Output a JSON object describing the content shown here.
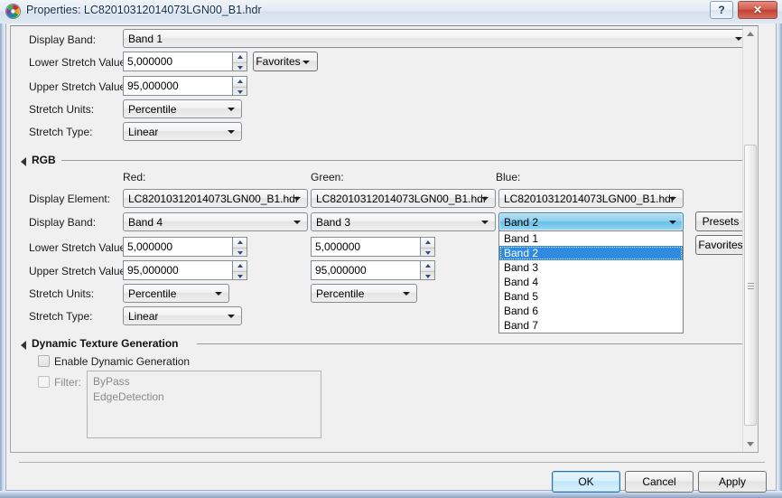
{
  "window": {
    "title": "Properties: LC82010312014073LGN00_B1.hdr",
    "icon": "aperture-logo-icon",
    "help_label": "?",
    "close_label": "✕"
  },
  "colors": {
    "selection": "#2f8ae0",
    "focus_combo": "#64bfe8",
    "default_button": "#bee6fa",
    "title_text": "#0d2b50"
  },
  "gray_section": {
    "rows": [
      {
        "label": "Display Band:",
        "value": "Band 1"
      },
      {
        "label": "Lower Stretch Value:",
        "value": "5,000000"
      },
      {
        "label": "Upper Stretch Value:",
        "value": "95,000000"
      },
      {
        "label": "Stretch Units:",
        "value": "Percentile"
      },
      {
        "label": "Stretch Type:",
        "value": "Linear"
      }
    ],
    "favorites_label": "Favorites"
  },
  "rgb_section": {
    "title": "RGB",
    "column_headers": [
      "Red:",
      "Green:",
      "Blue:"
    ],
    "row_labels": [
      "Display Element:",
      "Display Band:",
      "Lower Stretch Value:",
      "Upper Stretch Value:",
      "Stretch Units:",
      "Stretch Type:"
    ],
    "red": {
      "display_element": "LC82010312014073LGN00_B1.hdr",
      "display_band": "Band 4",
      "lower_stretch": "5,000000",
      "upper_stretch": "95,000000",
      "stretch_units": "Percentile",
      "stretch_type": "Linear"
    },
    "green": {
      "display_element": "LC82010312014073LGN00_B1.hdr",
      "display_band": "Band 3",
      "lower_stretch": "5,000000",
      "upper_stretch": "95,000000",
      "stretch_units": "Percentile"
    },
    "blue": {
      "display_element": "LC82010312014073LGN00_B1.hdr",
      "display_band": "Band 2"
    },
    "presets_label": "Presets",
    "favorites_label": "Favorites",
    "open_dropdown": {
      "selected": "Band 2",
      "options": [
        "Band 1",
        "Band 2",
        "Band 3",
        "Band 4",
        "Band 5",
        "Band 6",
        "Band 7"
      ]
    }
  },
  "dynamic_section": {
    "title": "Dynamic Texture Generation",
    "enable_label": "Enable Dynamic Generation",
    "filter_label": "Filter:",
    "filter_items": [
      "ByPass",
      "EdgeDetection"
    ]
  },
  "footer": {
    "ok_label": "OK",
    "cancel_label": "Cancel",
    "apply_label": "Apply"
  }
}
